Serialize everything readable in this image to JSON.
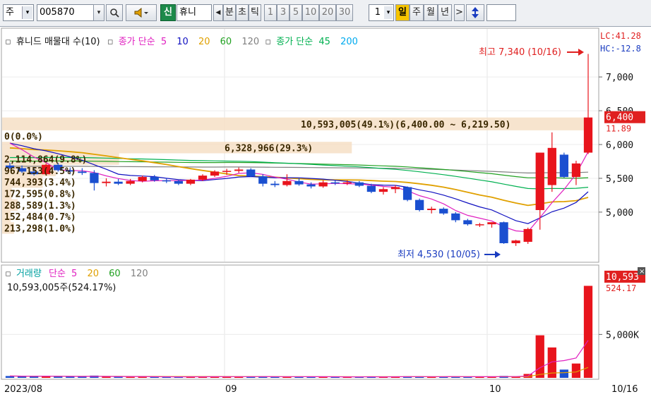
{
  "toolbar": {
    "market": "주",
    "code": "005870",
    "stock_name": "휴니",
    "stock_badge": "신",
    "period_items": [
      "분",
      "초",
      "틱"
    ],
    "interval_items": [
      "1",
      "3",
      "5",
      "10",
      "20",
      "30"
    ],
    "count_value": "1",
    "calendar_items": [
      "일",
      "주",
      "월",
      "년"
    ],
    "selected_calendar": "일",
    "more_label": ">"
  },
  "legend": {
    "price_title": "휴니드 매물대 수(10)",
    "ma_prefix": "종가 단순",
    "ma_periods": [
      "5",
      "10",
      "20",
      "60",
      "120"
    ],
    "ma_colors": [
      "#e020c0",
      "#1010c0",
      "#e0a000",
      "#20a020",
      "#808080"
    ],
    "ma2_prefix": "종가 단순",
    "ma2_periods": [
      "45",
      "200"
    ],
    "ma2_colors": [
      "#00b050",
      "#00aaee"
    ],
    "volume_title": "거래량",
    "vol_ma_prefix": "단순",
    "vol_ma_periods": [
      "5",
      "20",
      "60",
      "120"
    ],
    "vol_ma_colors": [
      "#e020c0",
      "#e0a000",
      "#20a020",
      "#808080"
    ]
  },
  "chart_data": {
    "type": "candlestick",
    "price_range": [
      4300,
      7450
    ],
    "price_ticks": [
      "7,000",
      "6,500",
      "6,000",
      "5,500",
      "5,000"
    ],
    "date_labels": [
      "2023/08",
      "09",
      "10",
      "10/16"
    ],
    "last_price_label": "6,400",
    "last_price_sub": "11.89",
    "lc_label": "LC:41.28",
    "hc_label": "HC:-12.8",
    "high_annotation": "최고 7,340 (10/16)",
    "low_annotation": "최저 4,530 (10/05)",
    "volume_profile": [
      {
        "label": "10,593,005(49.1%)(6,400.00 ~ 6,219.50)",
        "low": 6210,
        "high": 6400,
        "frac": 0.491
      },
      {
        "label": "0(0.0%)",
        "low": 6040,
        "high": 6210,
        "frac": 0.0
      },
      {
        "label": "6,328,966(29.3%)",
        "low": 5870,
        "high": 6040,
        "frac": 0.293
      },
      {
        "label": "2,114,864(9.8%)",
        "low": 5700,
        "high": 5870,
        "frac": 0.098
      },
      {
        "label": "967,153(4.5%)",
        "low": 5530,
        "high": 5700,
        "frac": 0.045
      },
      {
        "label": "744,393(3.4%)",
        "low": 5360,
        "high": 5530,
        "frac": 0.034
      },
      {
        "label": "172,595(0.8%)",
        "low": 5190,
        "high": 5360,
        "frac": 0.008
      },
      {
        "label": "288,589(1.3%)",
        "low": 5020,
        "high": 5190,
        "frac": 0.013
      },
      {
        "label": "152,484(0.7%)",
        "low": 4850,
        "high": 5020,
        "frac": 0.007
      },
      {
        "label": "213,298(1.0%)",
        "low": 4680,
        "high": 4850,
        "frac": 0.01
      }
    ],
    "candles": [
      {
        "o": 5690,
        "h": 5730,
        "l": 5640,
        "c": 5650
      },
      {
        "o": 5650,
        "h": 5690,
        "l": 5580,
        "c": 5600
      },
      {
        "o": 5600,
        "h": 5650,
        "l": 5540,
        "c": 5560
      },
      {
        "o": 5560,
        "h": 5720,
        "l": 5540,
        "c": 5700
      },
      {
        "o": 5700,
        "h": 5730,
        "l": 5600,
        "c": 5620
      },
      {
        "o": 5620,
        "h": 5660,
        "l": 5560,
        "c": 5600
      },
      {
        "o": 5600,
        "h": 5650,
        "l": 5550,
        "c": 5580
      },
      {
        "o": 5580,
        "h": 5620,
        "l": 5320,
        "c": 5430
      },
      {
        "o": 5430,
        "h": 5500,
        "l": 5380,
        "c": 5450
      },
      {
        "o": 5450,
        "h": 5490,
        "l": 5400,
        "c": 5420
      },
      {
        "o": 5420,
        "h": 5490,
        "l": 5400,
        "c": 5460
      },
      {
        "o": 5460,
        "h": 5540,
        "l": 5440,
        "c": 5520
      },
      {
        "o": 5520,
        "h": 5550,
        "l": 5450,
        "c": 5470
      },
      {
        "o": 5470,
        "h": 5500,
        "l": 5430,
        "c": 5460
      },
      {
        "o": 5460,
        "h": 5480,
        "l": 5400,
        "c": 5420
      },
      {
        "o": 5420,
        "h": 5490,
        "l": 5400,
        "c": 5480
      },
      {
        "o": 5480,
        "h": 5560,
        "l": 5460,
        "c": 5540
      },
      {
        "o": 5540,
        "h": 5620,
        "l": 5520,
        "c": 5600
      },
      {
        "o": 5600,
        "h": 5640,
        "l": 5550,
        "c": 5610
      },
      {
        "o": 5610,
        "h": 5660,
        "l": 5580,
        "c": 5630
      },
      {
        "o": 5630,
        "h": 5650,
        "l": 5520,
        "c": 5530
      },
      {
        "o": 5530,
        "h": 5560,
        "l": 5380,
        "c": 5420
      },
      {
        "o": 5420,
        "h": 5460,
        "l": 5370,
        "c": 5400
      },
      {
        "o": 5400,
        "h": 5560,
        "l": 5380,
        "c": 5460
      },
      {
        "o": 5460,
        "h": 5500,
        "l": 5390,
        "c": 5410
      },
      {
        "o": 5410,
        "h": 5440,
        "l": 5350,
        "c": 5380
      },
      {
        "o": 5380,
        "h": 5470,
        "l": 5360,
        "c": 5440
      },
      {
        "o": 5440,
        "h": 5470,
        "l": 5400,
        "c": 5430
      },
      {
        "o": 5430,
        "h": 5470,
        "l": 5400,
        "c": 5440
      },
      {
        "o": 5440,
        "h": 5460,
        "l": 5370,
        "c": 5390
      },
      {
        "o": 5390,
        "h": 5420,
        "l": 5280,
        "c": 5300
      },
      {
        "o": 5300,
        "h": 5370,
        "l": 5260,
        "c": 5340
      },
      {
        "o": 5340,
        "h": 5400,
        "l": 5280,
        "c": 5370
      },
      {
        "o": 5370,
        "h": 5380,
        "l": 5160,
        "c": 5180
      },
      {
        "o": 5180,
        "h": 5200,
        "l": 5010,
        "c": 5030
      },
      {
        "o": 5030,
        "h": 5080,
        "l": 4980,
        "c": 5050
      },
      {
        "o": 5050,
        "h": 5070,
        "l": 4960,
        "c": 4980
      },
      {
        "o": 4980,
        "h": 5000,
        "l": 4850,
        "c": 4880
      },
      {
        "o": 4880,
        "h": 4900,
        "l": 4800,
        "c": 4820
      },
      {
        "o": 4820,
        "h": 4840,
        "l": 4780,
        "c": 4820
      },
      {
        "o": 4820,
        "h": 4850,
        "l": 4770,
        "c": 4850
      },
      {
        "o": 4850,
        "h": 4860,
        "l": 4530,
        "c": 4540
      },
      {
        "o": 4540,
        "h": 4590,
        "l": 4500,
        "c": 4580
      },
      {
        "o": 4560,
        "h": 4770,
        "l": 4530,
        "c": 4750
      },
      {
        "o": 5030,
        "h": 5880,
        "l": 4740,
        "c": 5880
      },
      {
        "o": 5400,
        "h": 6180,
        "l": 5300,
        "c": 5950
      },
      {
        "o": 5850,
        "h": 5880,
        "l": 5510,
        "c": 5520
      },
      {
        "o": 5520,
        "h": 5760,
        "l": 5400,
        "c": 5720
      },
      {
        "o": 5880,
        "h": 7340,
        "l": 5860,
        "c": 6400
      }
    ],
    "volume_range": [
      0,
      11200000
    ],
    "volume_ticks": [
      "5,000K"
    ],
    "volume_last_label": "10,593",
    "volume_last_sub": "524.17",
    "volume_info": "10,593,005주(524.17%)",
    "volumes": [
      210000,
      180000,
      160000,
      230000,
      150000,
      140000,
      130000,
      260000,
      140000,
      120000,
      110000,
      140000,
      120000,
      110000,
      100000,
      120000,
      150000,
      170000,
      130000,
      120000,
      140000,
      160000,
      120000,
      150000,
      120000,
      110000,
      130000,
      100000,
      100000,
      110000,
      150000,
      120000,
      110000,
      180000,
      170000,
      120000,
      130000,
      150000,
      130000,
      110000,
      120000,
      220000,
      150000,
      450000,
      4900000,
      3500000,
      950000,
      1650000,
      10593005
    ]
  }
}
